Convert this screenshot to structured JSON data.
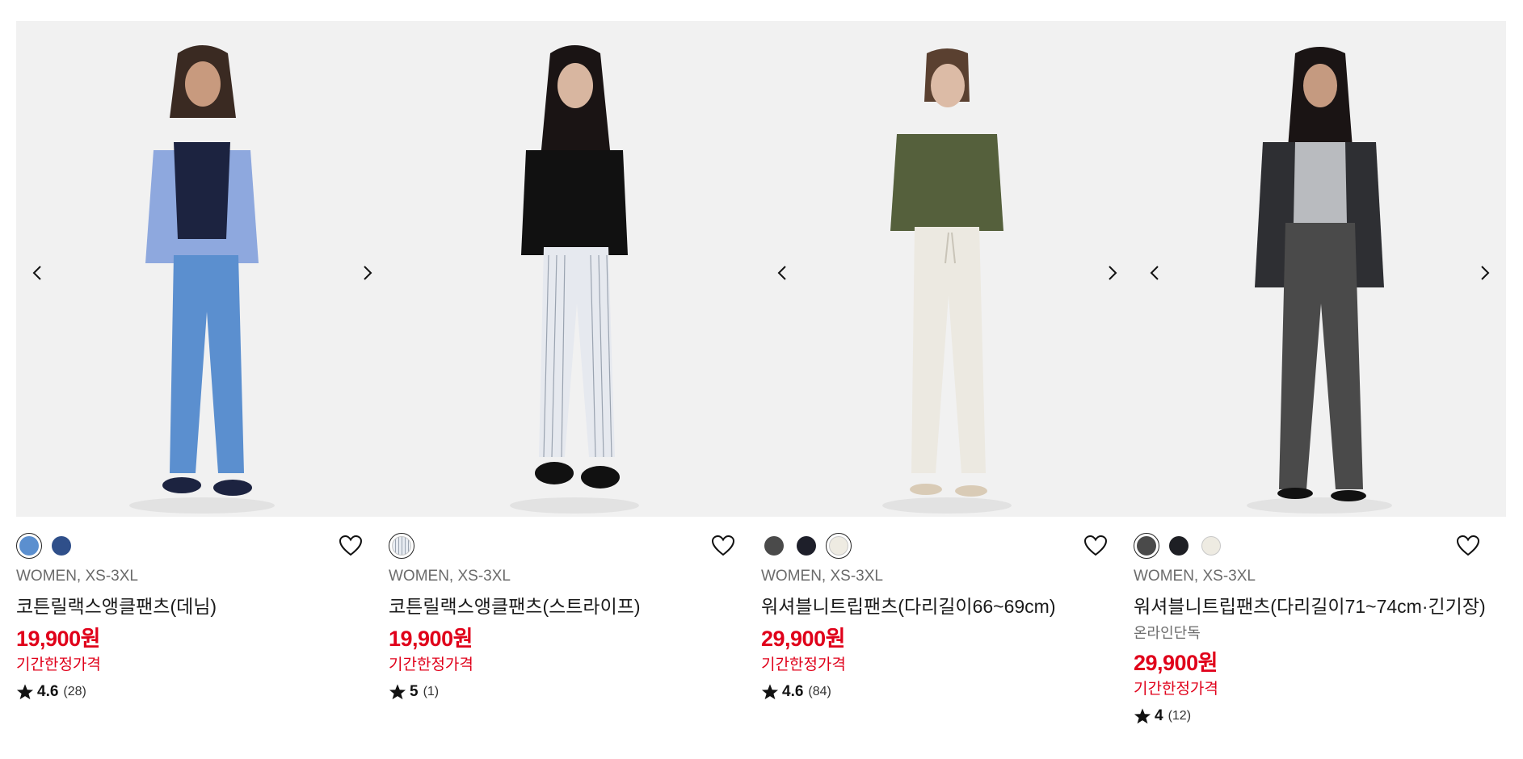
{
  "colors": {
    "price_red": "#e0001a",
    "text_grey": "#6b6b6b",
    "image_bg": "#efefef"
  },
  "icons": {
    "prev": "chevron-left-icon",
    "next": "chevron-right-icon",
    "wishlist": "heart-outline-icon",
    "rating": "star-icon"
  },
  "products": [
    {
      "category": "WOMEN, XS-3XL",
      "name": "코튼릴랙스앵클팬츠(데님)",
      "online_label": "",
      "price": "19,900원",
      "promo": "기간한정가격",
      "rating": "4.6",
      "review_count": "(28)",
      "swatches": [
        {
          "color": "#5b8fcf",
          "selected": true
        },
        {
          "color": "#2f4f8a",
          "selected": false
        }
      ]
    },
    {
      "category": "WOMEN, XS-3XL",
      "name": "코튼릴랙스앵클팬츠(스트라이프)",
      "online_label": "",
      "price": "19,900원",
      "promo": "기간한정가격",
      "rating": "5",
      "review_count": "(1)",
      "swatches": [
        {
          "color": "#e8ecf2",
          "selected": true
        }
      ]
    },
    {
      "category": "WOMEN, XS-3XL",
      "name": "워셔블니트립팬츠(다리길이66~69cm)",
      "online_label": "",
      "price": "29,900원",
      "promo": "기간한정가격",
      "rating": "4.6",
      "review_count": "(84)",
      "swatches": [
        {
          "color": "#4a4a4a",
          "selected": false
        },
        {
          "color": "#1e1f2a",
          "selected": false
        },
        {
          "color": "#eeebe2",
          "selected": true
        }
      ]
    },
    {
      "category": "WOMEN, XS-3XL",
      "name": "워셔블니트립팬츠(다리길이71~74cm·긴기장)",
      "online_label": "온라인단독",
      "price": "29,900원",
      "promo": "기간한정가격",
      "rating": "4",
      "review_count": "(12)",
      "swatches": [
        {
          "color": "#4a4a4a",
          "selected": true
        },
        {
          "color": "#1e1f24",
          "selected": false
        },
        {
          "color": "#eeebe2",
          "selected": false
        }
      ]
    }
  ]
}
